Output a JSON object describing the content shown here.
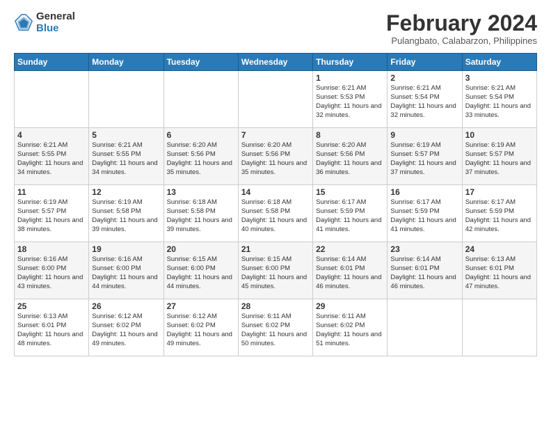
{
  "header": {
    "logo_general": "General",
    "logo_blue": "Blue",
    "title": "February 2024",
    "subtitle": "Pulangbato, Calabarzon, Philippines"
  },
  "days_of_week": [
    "Sunday",
    "Monday",
    "Tuesday",
    "Wednesday",
    "Thursday",
    "Friday",
    "Saturday"
  ],
  "weeks": [
    [
      {
        "day": "",
        "info": ""
      },
      {
        "day": "",
        "info": ""
      },
      {
        "day": "",
        "info": ""
      },
      {
        "day": "",
        "info": ""
      },
      {
        "day": "1",
        "info": "Sunrise: 6:21 AM\nSunset: 5:53 PM\nDaylight: 11 hours and 32 minutes."
      },
      {
        "day": "2",
        "info": "Sunrise: 6:21 AM\nSunset: 5:54 PM\nDaylight: 11 hours and 32 minutes."
      },
      {
        "day": "3",
        "info": "Sunrise: 6:21 AM\nSunset: 5:54 PM\nDaylight: 11 hours and 33 minutes."
      }
    ],
    [
      {
        "day": "4",
        "info": "Sunrise: 6:21 AM\nSunset: 5:55 PM\nDaylight: 11 hours and 34 minutes."
      },
      {
        "day": "5",
        "info": "Sunrise: 6:21 AM\nSunset: 5:55 PM\nDaylight: 11 hours and 34 minutes."
      },
      {
        "day": "6",
        "info": "Sunrise: 6:20 AM\nSunset: 5:56 PM\nDaylight: 11 hours and 35 minutes."
      },
      {
        "day": "7",
        "info": "Sunrise: 6:20 AM\nSunset: 5:56 PM\nDaylight: 11 hours and 35 minutes."
      },
      {
        "day": "8",
        "info": "Sunrise: 6:20 AM\nSunset: 5:56 PM\nDaylight: 11 hours and 36 minutes."
      },
      {
        "day": "9",
        "info": "Sunrise: 6:19 AM\nSunset: 5:57 PM\nDaylight: 11 hours and 37 minutes."
      },
      {
        "day": "10",
        "info": "Sunrise: 6:19 AM\nSunset: 5:57 PM\nDaylight: 11 hours and 37 minutes."
      }
    ],
    [
      {
        "day": "11",
        "info": "Sunrise: 6:19 AM\nSunset: 5:57 PM\nDaylight: 11 hours and 38 minutes."
      },
      {
        "day": "12",
        "info": "Sunrise: 6:19 AM\nSunset: 5:58 PM\nDaylight: 11 hours and 39 minutes."
      },
      {
        "day": "13",
        "info": "Sunrise: 6:18 AM\nSunset: 5:58 PM\nDaylight: 11 hours and 39 minutes."
      },
      {
        "day": "14",
        "info": "Sunrise: 6:18 AM\nSunset: 5:58 PM\nDaylight: 11 hours and 40 minutes."
      },
      {
        "day": "15",
        "info": "Sunrise: 6:17 AM\nSunset: 5:59 PM\nDaylight: 11 hours and 41 minutes."
      },
      {
        "day": "16",
        "info": "Sunrise: 6:17 AM\nSunset: 5:59 PM\nDaylight: 11 hours and 41 minutes."
      },
      {
        "day": "17",
        "info": "Sunrise: 6:17 AM\nSunset: 5:59 PM\nDaylight: 11 hours and 42 minutes."
      }
    ],
    [
      {
        "day": "18",
        "info": "Sunrise: 6:16 AM\nSunset: 6:00 PM\nDaylight: 11 hours and 43 minutes."
      },
      {
        "day": "19",
        "info": "Sunrise: 6:16 AM\nSunset: 6:00 PM\nDaylight: 11 hours and 44 minutes."
      },
      {
        "day": "20",
        "info": "Sunrise: 6:15 AM\nSunset: 6:00 PM\nDaylight: 11 hours and 44 minutes."
      },
      {
        "day": "21",
        "info": "Sunrise: 6:15 AM\nSunset: 6:00 PM\nDaylight: 11 hours and 45 minutes."
      },
      {
        "day": "22",
        "info": "Sunrise: 6:14 AM\nSunset: 6:01 PM\nDaylight: 11 hours and 46 minutes."
      },
      {
        "day": "23",
        "info": "Sunrise: 6:14 AM\nSunset: 6:01 PM\nDaylight: 11 hours and 46 minutes."
      },
      {
        "day": "24",
        "info": "Sunrise: 6:13 AM\nSunset: 6:01 PM\nDaylight: 11 hours and 47 minutes."
      }
    ],
    [
      {
        "day": "25",
        "info": "Sunrise: 6:13 AM\nSunset: 6:01 PM\nDaylight: 11 hours and 48 minutes."
      },
      {
        "day": "26",
        "info": "Sunrise: 6:12 AM\nSunset: 6:02 PM\nDaylight: 11 hours and 49 minutes."
      },
      {
        "day": "27",
        "info": "Sunrise: 6:12 AM\nSunset: 6:02 PM\nDaylight: 11 hours and 49 minutes."
      },
      {
        "day": "28",
        "info": "Sunrise: 6:11 AM\nSunset: 6:02 PM\nDaylight: 11 hours and 50 minutes."
      },
      {
        "day": "29",
        "info": "Sunrise: 6:11 AM\nSunset: 6:02 PM\nDaylight: 11 hours and 51 minutes."
      },
      {
        "day": "",
        "info": ""
      },
      {
        "day": "",
        "info": ""
      }
    ]
  ]
}
